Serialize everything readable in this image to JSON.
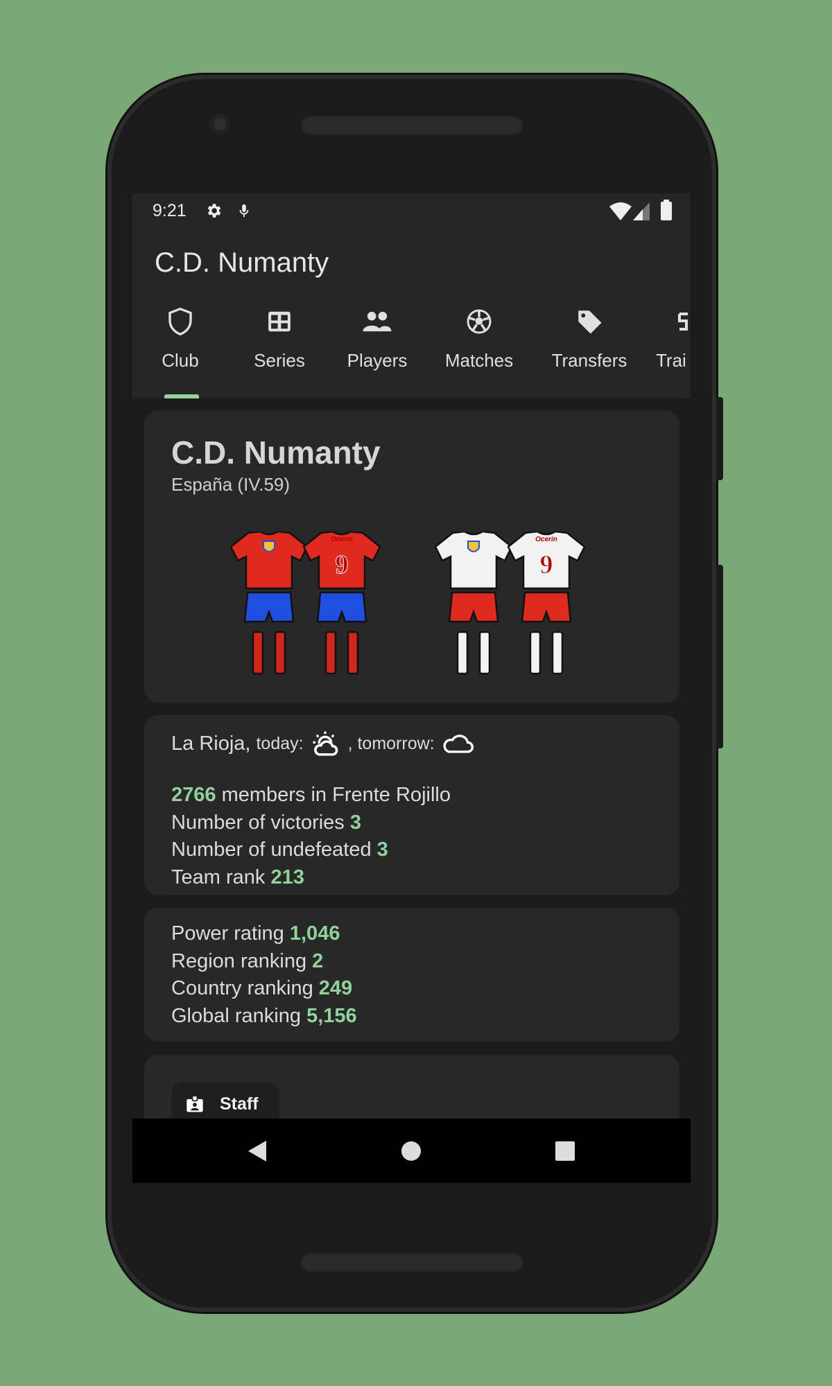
{
  "status_bar": {
    "time": "9:21",
    "icons": [
      "gear-icon",
      "mic-icon",
      "wifi-icon",
      "signal-icon",
      "battery-icon"
    ]
  },
  "app_bar": {
    "title": "C.D. Numanty"
  },
  "tabs": [
    {
      "label": "Club",
      "icon": "shield-icon",
      "selected": true
    },
    {
      "label": "Series",
      "icon": "grid-icon"
    },
    {
      "label": "Players",
      "icon": "people-icon"
    },
    {
      "label": "Matches",
      "icon": "soccer-ball-icon"
    },
    {
      "label": "Transfers",
      "icon": "tag-icon"
    },
    {
      "label": "Trai",
      "icon": "training-icon"
    }
  ],
  "club_card": {
    "name": "C.D. Numanty",
    "subtitle": "España (IV.59)",
    "kit_back_name": "Ocerin",
    "kit_back_number": "9",
    "kits": {
      "home": {
        "shirt": "#e02a1f",
        "shorts": "#1f4fe0",
        "socks": "#d0261b"
      },
      "away": {
        "shirt": "#f2f2f2",
        "shorts": "#e02a1f",
        "socks": "#f2f2f2"
      }
    }
  },
  "info_card": {
    "region": "La Rioja,",
    "today_label": "today:",
    "tomorrow_label": ", tomorrow:",
    "today_weather": "partly-cloudy-icon",
    "tomorrow_weather": "cloud-icon",
    "members_value": "2766",
    "members_label": "members in Frente Rojillo",
    "victories_label": "Number of victories",
    "victories_value": "3",
    "undefeated_label": "Number of undefeated",
    "undefeated_value": "3",
    "rank_label": "Team rank",
    "rank_value": "213"
  },
  "ranking_card": {
    "power_label": "Power rating",
    "power_value": "1,046",
    "region_label": "Region ranking",
    "region_value": "2",
    "country_label": "Country ranking",
    "country_value": "249",
    "global_label": "Global ranking",
    "global_value": "5,156"
  },
  "staff_card": {
    "button_label": "Staff",
    "icon": "badge-icon"
  },
  "colors": {
    "accent": "#8fd39a",
    "background": "#7aa877",
    "surface": "#282828"
  }
}
